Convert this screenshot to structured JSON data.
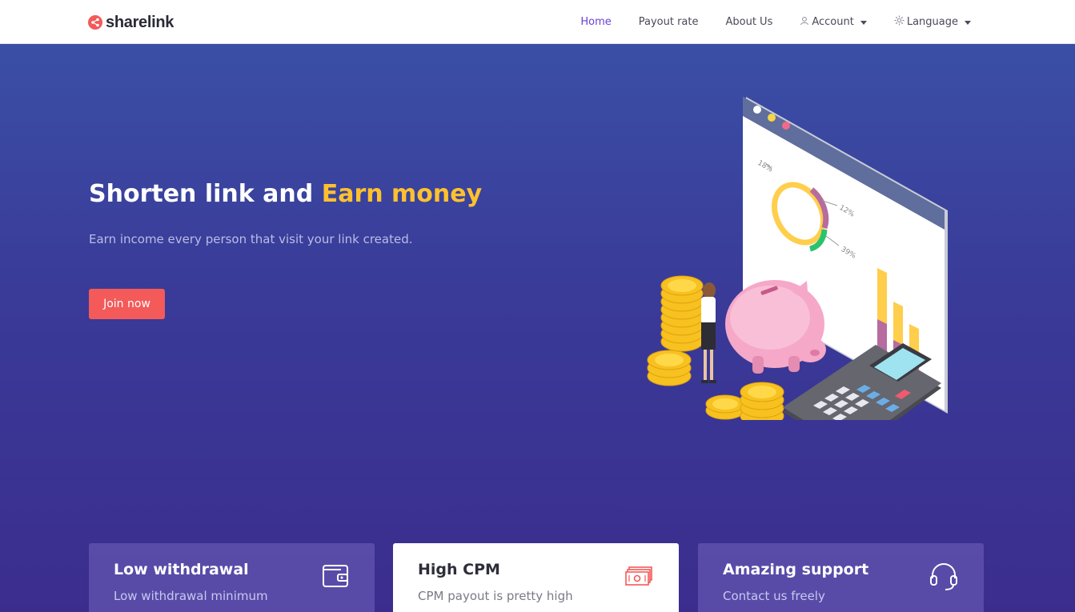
{
  "brand": {
    "name": "sharelink",
    "icon": "share-icon",
    "color": "#f25a59"
  },
  "nav": {
    "items": [
      {
        "label": "Home",
        "active": true
      },
      {
        "label": "Payout rate",
        "active": false
      },
      {
        "label": "About Us",
        "active": false
      },
      {
        "label": "Account",
        "active": false,
        "icon": "user-icon",
        "dropdown": true
      },
      {
        "label": "Language",
        "active": false,
        "icon": "gear-icon",
        "dropdown": true
      }
    ]
  },
  "hero": {
    "title_main": "Shorten link and ",
    "title_accent": "Earn money",
    "subtitle": "Earn income every person that visit your link created.",
    "cta_label": "Join now",
    "illustration_labels": [
      "18%",
      "12%",
      "39%"
    ]
  },
  "cards": [
    {
      "title": "Low withdrawal",
      "text": "Low withdrawal minimum",
      "icon": "wallet-icon"
    },
    {
      "title": "High CPM",
      "text": "CPM payout is pretty high",
      "icon": "money-icon"
    },
    {
      "title": "Amazing support",
      "text": "Contact us freely",
      "icon": "headset-icon"
    }
  ],
  "colors": {
    "accent": "#ffc12e",
    "cta": "#f35a59",
    "nav_active": "#6a40d8",
    "hero_top": "#3a4fa6",
    "hero_bottom": "#3b2d8d"
  }
}
